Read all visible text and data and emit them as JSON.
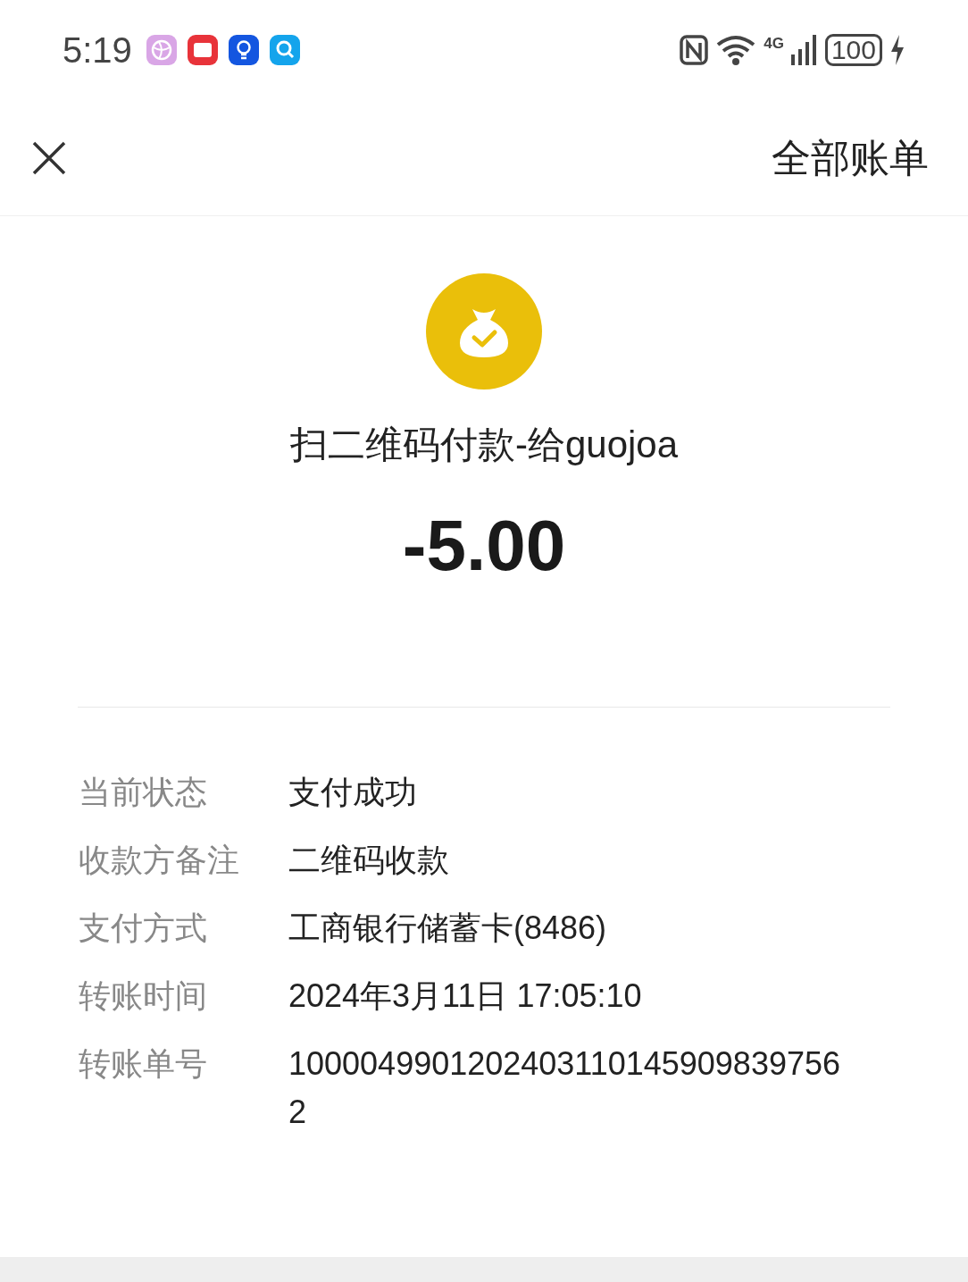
{
  "status_bar": {
    "time": "5:19",
    "network": "4G",
    "battery": "100"
  },
  "header": {
    "action": "全部账单"
  },
  "payment": {
    "title": "扫二维码付款-给guojoa",
    "amount": "-5.00"
  },
  "details": [
    {
      "label": "当前状态",
      "value": "支付成功"
    },
    {
      "label": "收款方备注",
      "value": "二维码收款"
    },
    {
      "label": "支付方式",
      "value": "工商银行储蓄卡(8486)"
    },
    {
      "label": "转账时间",
      "value": "2024年3月11日 17:05:10"
    },
    {
      "label": "转账单号",
      "value": "10000499012024031101459098397562"
    }
  ]
}
